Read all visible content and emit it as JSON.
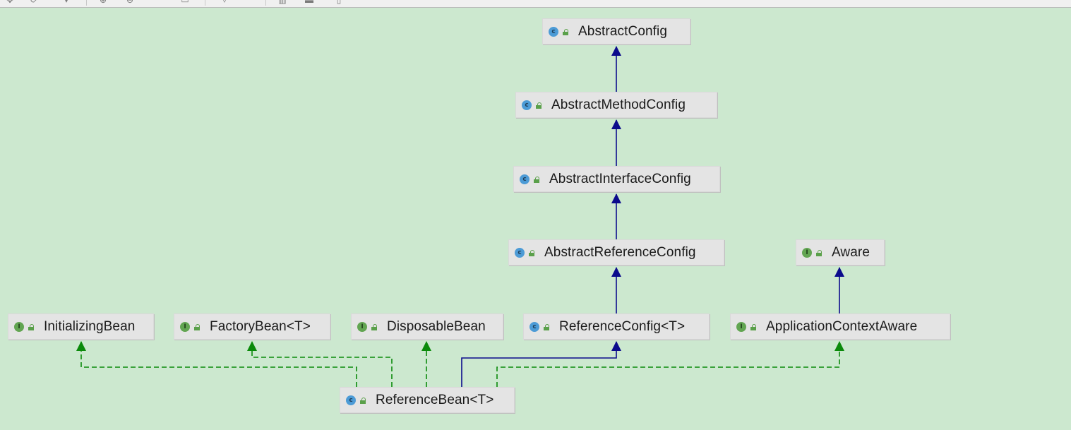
{
  "diagram": {
    "nodes": [
      {
        "id": "AbstractConfig",
        "label": "AbstractConfig",
        "kind": "class",
        "kind_letter": "c"
      },
      {
        "id": "AbstractMethodConfig",
        "label": "AbstractMethodConfig",
        "kind": "class",
        "kind_letter": "c"
      },
      {
        "id": "AbstractInterfaceConfig",
        "label": "AbstractInterfaceConfig",
        "kind": "class",
        "kind_letter": "c"
      },
      {
        "id": "AbstractReferenceConfig",
        "label": "AbstractReferenceConfig",
        "kind": "class",
        "kind_letter": "c"
      },
      {
        "id": "Aware",
        "label": "Aware",
        "kind": "interface",
        "kind_letter": "I"
      },
      {
        "id": "InitializingBean",
        "label": "InitializingBean",
        "kind": "interface",
        "kind_letter": "I"
      },
      {
        "id": "FactoryBean",
        "label": "FactoryBean<T>",
        "kind": "interface",
        "kind_letter": "I"
      },
      {
        "id": "DisposableBean",
        "label": "DisposableBean",
        "kind": "interface",
        "kind_letter": "I"
      },
      {
        "id": "ReferenceConfig",
        "label": "ReferenceConfig<T>",
        "kind": "class",
        "kind_letter": "c"
      },
      {
        "id": "ApplicationContextAware",
        "label": "ApplicationContextAware",
        "kind": "interface",
        "kind_letter": "I"
      },
      {
        "id": "ReferenceBean",
        "label": "ReferenceBean<T>",
        "kind": "class",
        "kind_letter": "c"
      }
    ],
    "edges": [
      {
        "from": "AbstractMethodConfig",
        "to": "AbstractConfig",
        "type": "extends"
      },
      {
        "from": "AbstractInterfaceConfig",
        "to": "AbstractMethodConfig",
        "type": "extends"
      },
      {
        "from": "AbstractReferenceConfig",
        "to": "AbstractInterfaceConfig",
        "type": "extends"
      },
      {
        "from": "ReferenceConfig",
        "to": "AbstractReferenceConfig",
        "type": "extends"
      },
      {
        "from": "ApplicationContextAware",
        "to": "Aware",
        "type": "extends"
      },
      {
        "from": "ReferenceBean",
        "to": "ReferenceConfig",
        "type": "extends"
      },
      {
        "from": "ReferenceBean",
        "to": "InitializingBean",
        "type": "implements"
      },
      {
        "from": "ReferenceBean",
        "to": "FactoryBean",
        "type": "implements"
      },
      {
        "from": "ReferenceBean",
        "to": "DisposableBean",
        "type": "implements"
      },
      {
        "from": "ReferenceBean",
        "to": "ApplicationContextAware",
        "type": "implements"
      }
    ],
    "colors": {
      "background": "#cce8cf",
      "node_fill": "#e4e4e4",
      "extends_edge": "#0b0b8c",
      "implements_edge": "#0a8a0a"
    }
  }
}
